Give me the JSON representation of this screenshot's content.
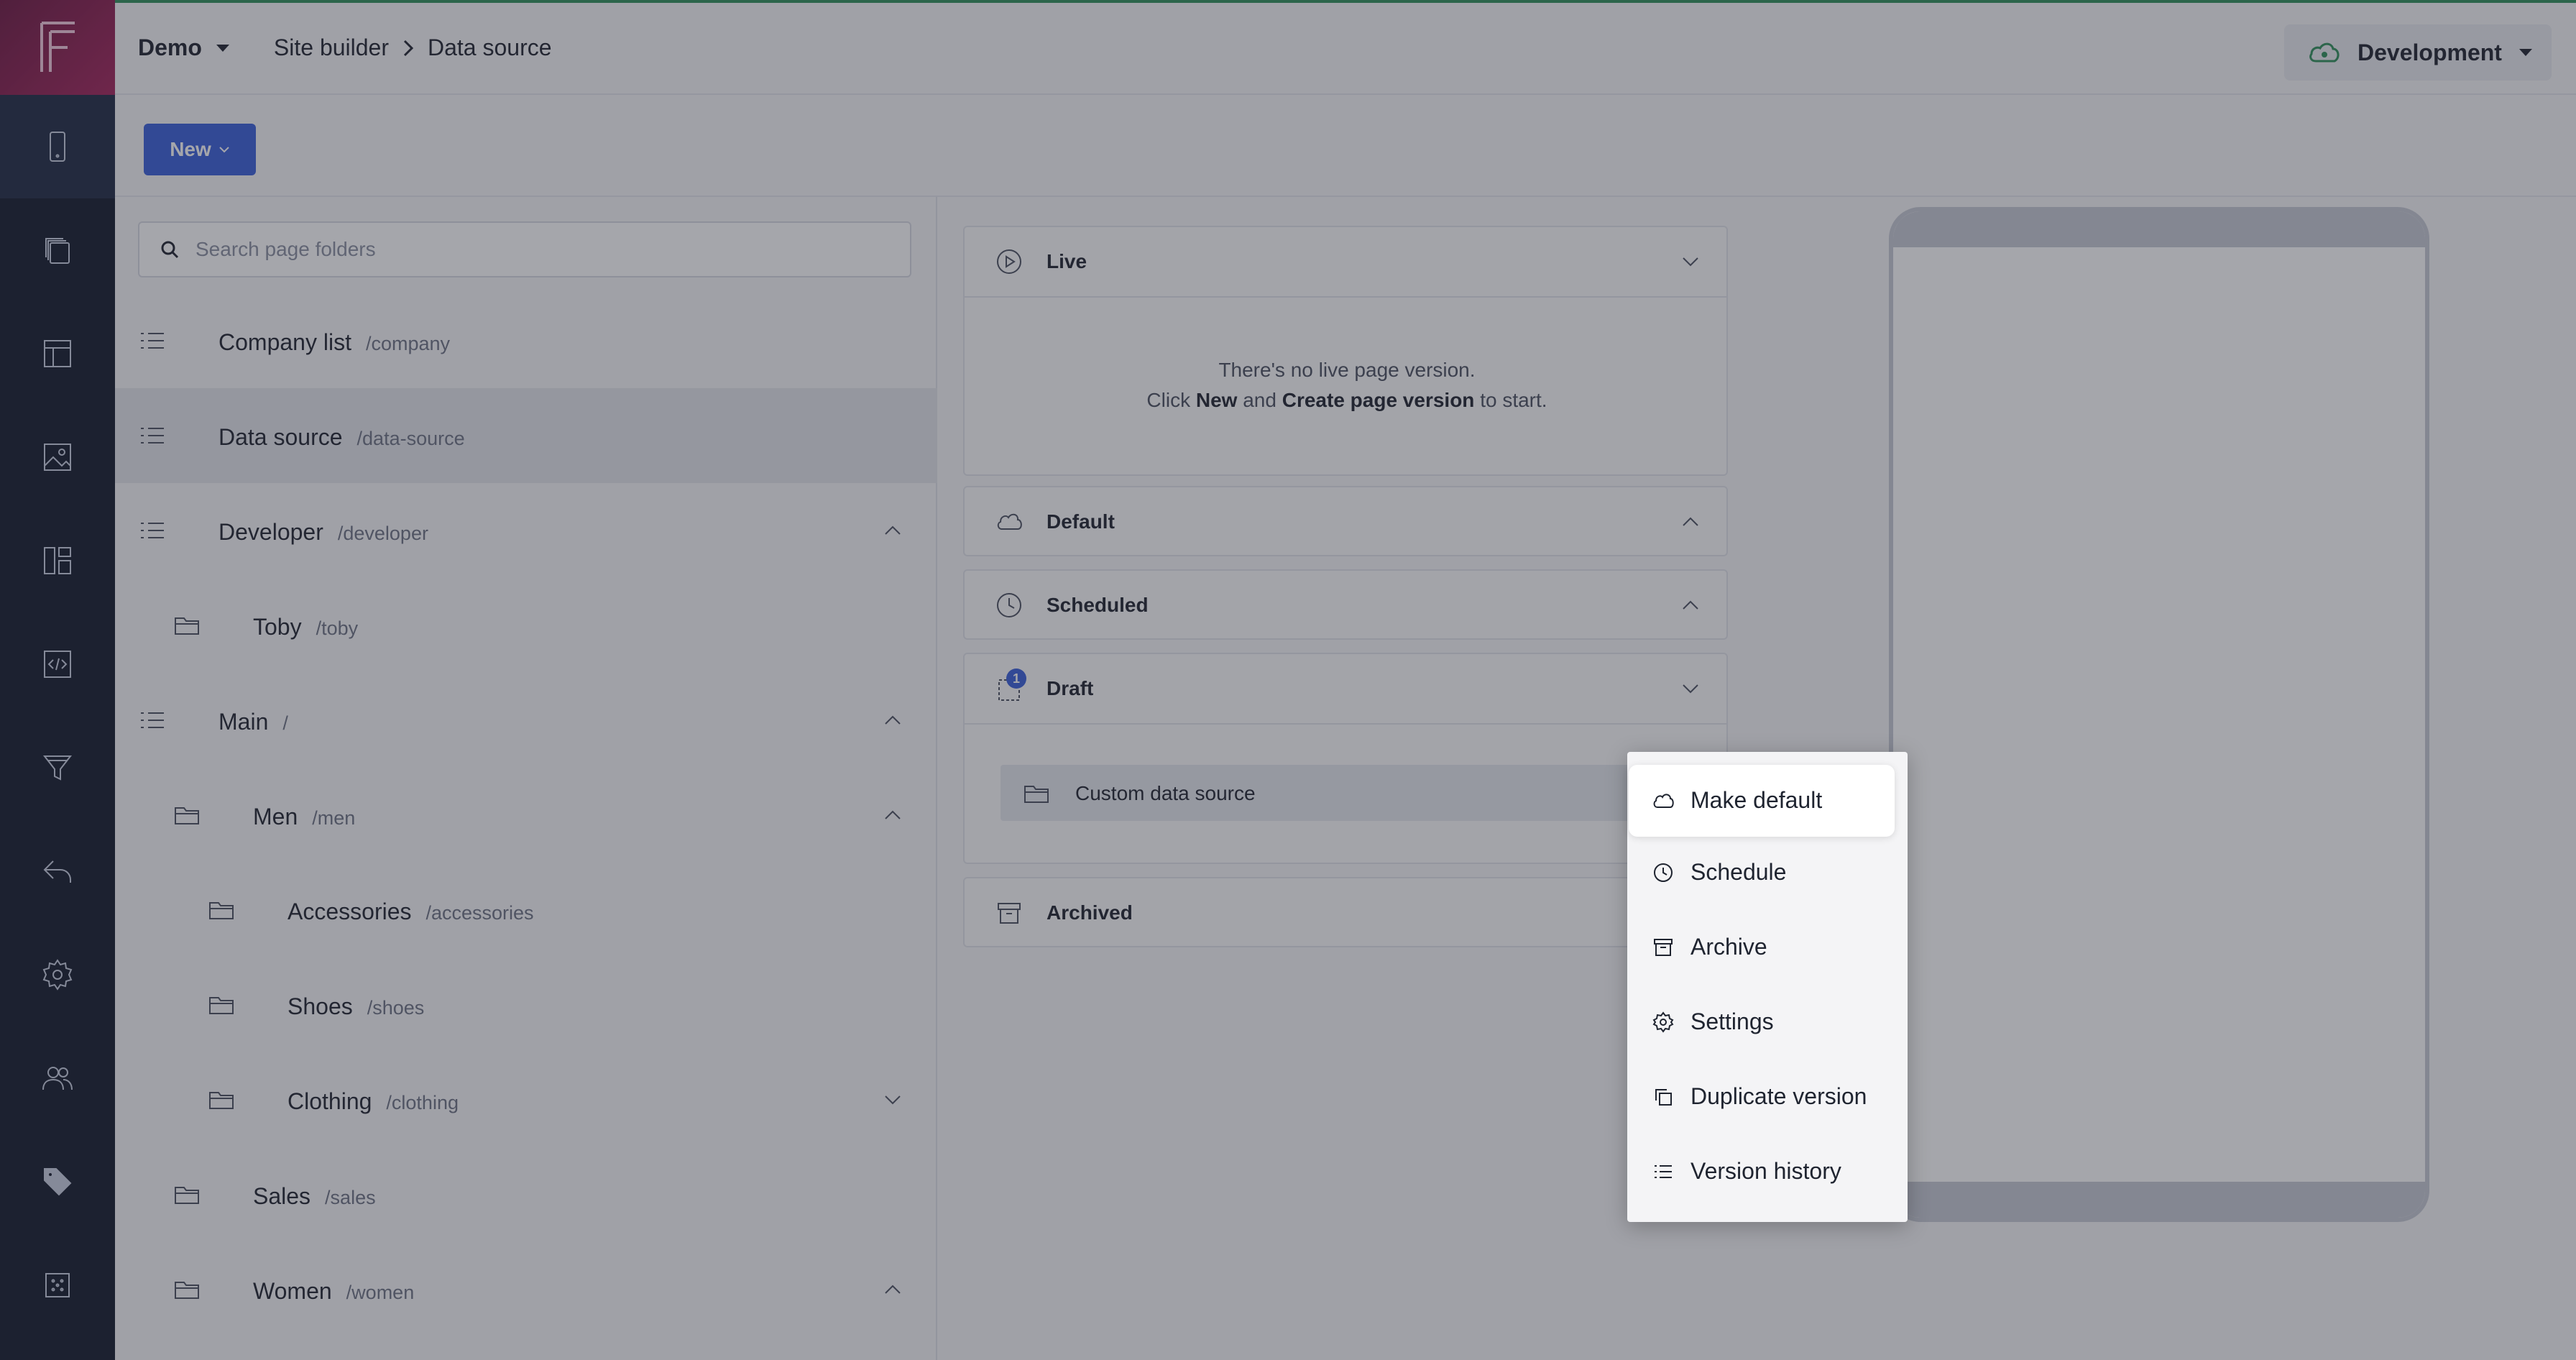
{
  "breadcrumb": {
    "project": "Demo",
    "section": "Site builder",
    "page": "Data source"
  },
  "environment": {
    "label": "Development"
  },
  "toolbar": {
    "new_label": "New"
  },
  "search": {
    "placeholder": "Search page folders"
  },
  "tree": [
    {
      "name": "Company list",
      "path": "/company",
      "icon": "list-icon",
      "selected": false
    },
    {
      "name": "Data source",
      "path": "/data-source",
      "icon": "list-icon",
      "selected": true
    },
    {
      "name": "Developer",
      "path": "/developer",
      "icon": "list-icon",
      "chevron": "up"
    },
    {
      "name": "Toby",
      "path": "/toby",
      "icon": "folder-icon"
    },
    {
      "name": "Main",
      "path": "/",
      "icon": "list-icon",
      "chevron": "up"
    },
    {
      "name": "Men",
      "path": "/men",
      "icon": "folder-icon",
      "chevron": "up"
    },
    {
      "name": "Accessories",
      "path": "/accessories",
      "icon": "folder-icon"
    },
    {
      "name": "Shoes",
      "path": "/shoes",
      "icon": "folder-icon"
    },
    {
      "name": "Clothing",
      "path": "/clothing",
      "icon": "folder-icon",
      "chevron": "down"
    },
    {
      "name": "Sales",
      "path": "/sales",
      "icon": "folder-icon"
    },
    {
      "name": "Women",
      "path": "/women",
      "icon": "folder-icon",
      "chevron": "up"
    }
  ],
  "versions": {
    "live": {
      "title": "Live",
      "empty_line1": "There's no live page version.",
      "empty_click": "Click",
      "empty_new": "New",
      "empty_and": "and",
      "empty_create": "Create page version",
      "empty_end": "to start."
    },
    "default": {
      "title": "Default"
    },
    "scheduled": {
      "title": "Scheduled"
    },
    "draft": {
      "title": "Draft",
      "badge": "1",
      "item": "Custom data source"
    },
    "archived": {
      "title": "Archived"
    }
  },
  "context_menu": [
    {
      "label": "Make default",
      "icon": "cloud-icon"
    },
    {
      "label": "Schedule",
      "icon": "clock-icon"
    },
    {
      "label": "Archive",
      "icon": "archive-icon"
    },
    {
      "label": "Settings",
      "icon": "gear-icon"
    },
    {
      "label": "Duplicate version",
      "icon": "duplicate-icon"
    },
    {
      "label": "Version history",
      "icon": "list-icon"
    }
  ]
}
